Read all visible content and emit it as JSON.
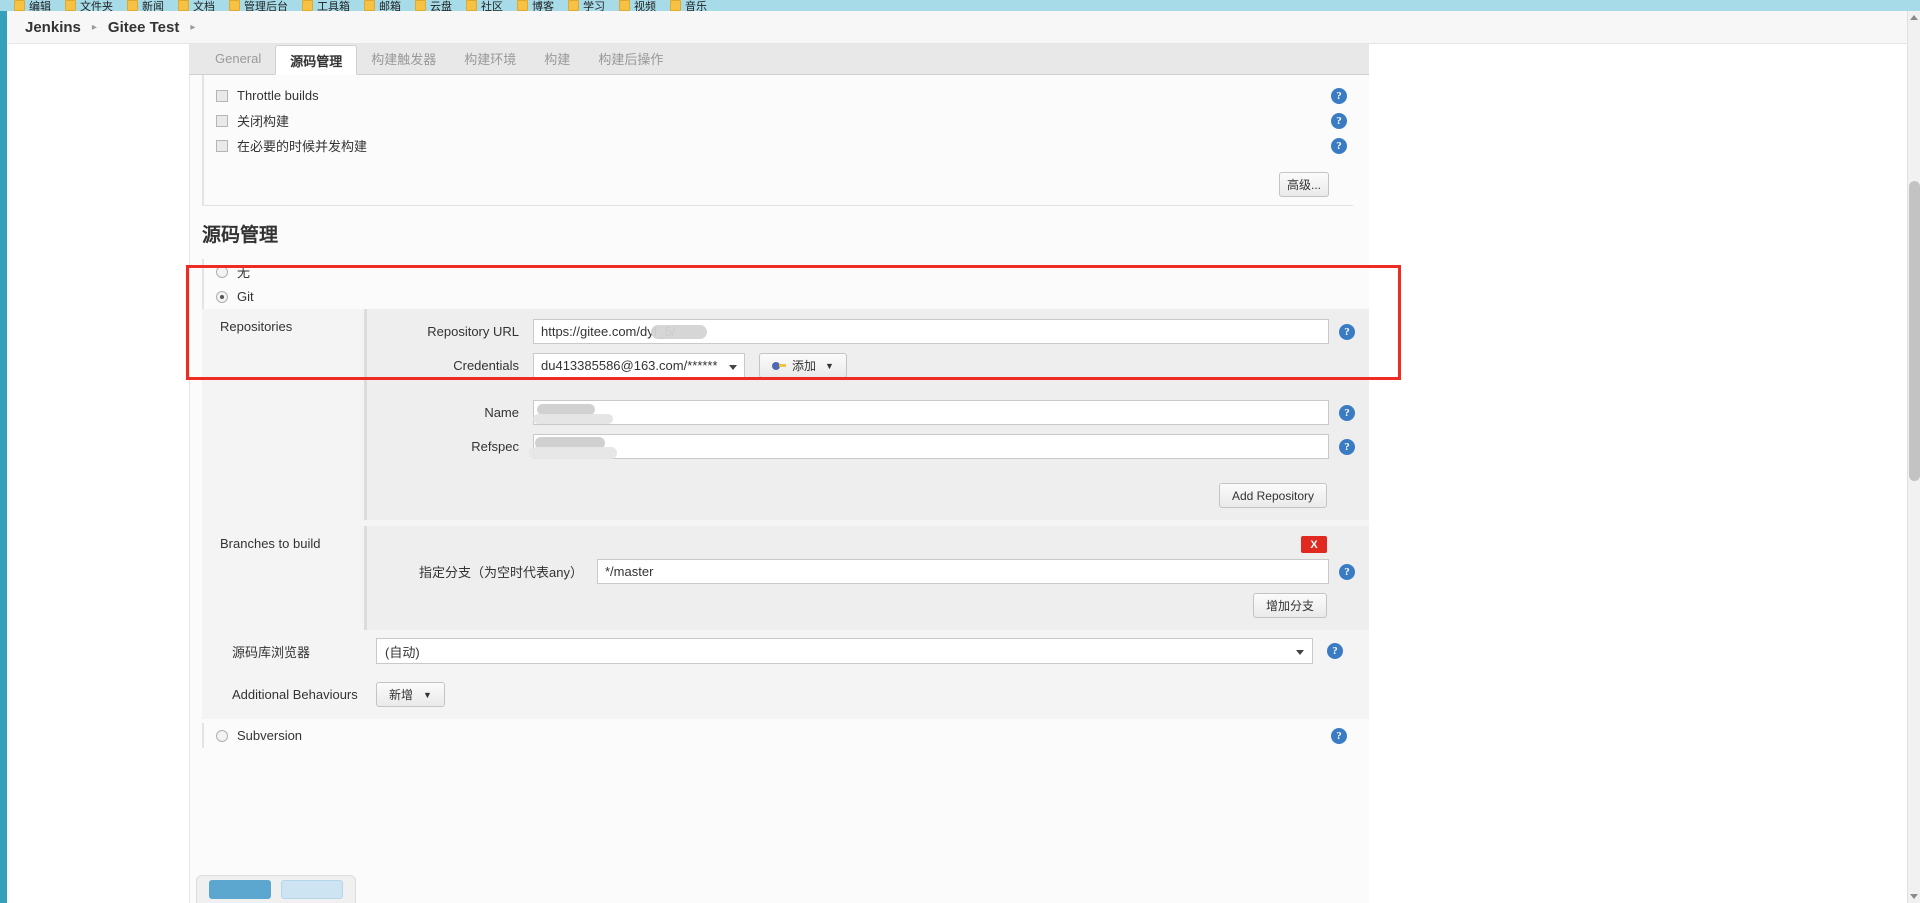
{
  "browser": {
    "bookmarks": [
      "编辑",
      "文件夹",
      "新闻",
      "文档",
      "管理后台",
      "工具箱",
      "邮箱",
      "云盘",
      "社区",
      "博客",
      "学习",
      "视频",
      "音乐"
    ]
  },
  "breadcrumb": {
    "items": [
      "Jenkins",
      "Gitee Test"
    ],
    "separator": "▸"
  },
  "tabs": [
    {
      "label": "General",
      "active": false
    },
    {
      "label": "源码管理",
      "active": true
    },
    {
      "label": "构建触发器",
      "active": false
    },
    {
      "label": "构建环境",
      "active": false
    },
    {
      "label": "构建",
      "active": false
    },
    {
      "label": "构建后操作",
      "active": false
    }
  ],
  "general_options": {
    "checkboxes": [
      {
        "label": "Throttle builds",
        "checked": false
      },
      {
        "label": "关闭构建",
        "checked": false
      },
      {
        "label": "在必要的时候并发构建",
        "checked": false
      }
    ],
    "advanced_button": "高级..."
  },
  "scm": {
    "heading": "源码管理",
    "radios": [
      {
        "label": "无",
        "selected": false
      },
      {
        "label": "Git",
        "selected": true
      },
      {
        "label": "Subversion",
        "selected": false
      }
    ],
    "repositories": {
      "title": "Repositories",
      "repository_url": {
        "label": "Repository URL",
        "value": "https://gitee.com/dyf_5/",
        "redacted": true
      },
      "credentials": {
        "label": "Credentials",
        "value": "du413385586@163.com/******",
        "add_button": "添加"
      },
      "name": {
        "label": "Name",
        "value": "",
        "redacted": true
      },
      "refspec": {
        "label": "Refspec",
        "value": "",
        "redacted": true
      },
      "add_repository_button": "Add Repository"
    },
    "branches": {
      "title": "Branches to build",
      "branch_label": "指定分支（为空时代表any）",
      "branch_value": "*/master",
      "delete_button": "X",
      "add_branch_button": "增加分支"
    },
    "browser": {
      "title": "源码库浏览器",
      "value": "(自动)"
    },
    "additional_behaviours": {
      "title": "Additional Behaviours",
      "add_button": "新增"
    }
  },
  "help_icon_glyph": "?",
  "colors": {
    "highlight": "#ee2b24",
    "help_blue": "#3a7cc4",
    "delete_red": "#e02a21",
    "bookmark_bar": "#a7dbe8"
  }
}
